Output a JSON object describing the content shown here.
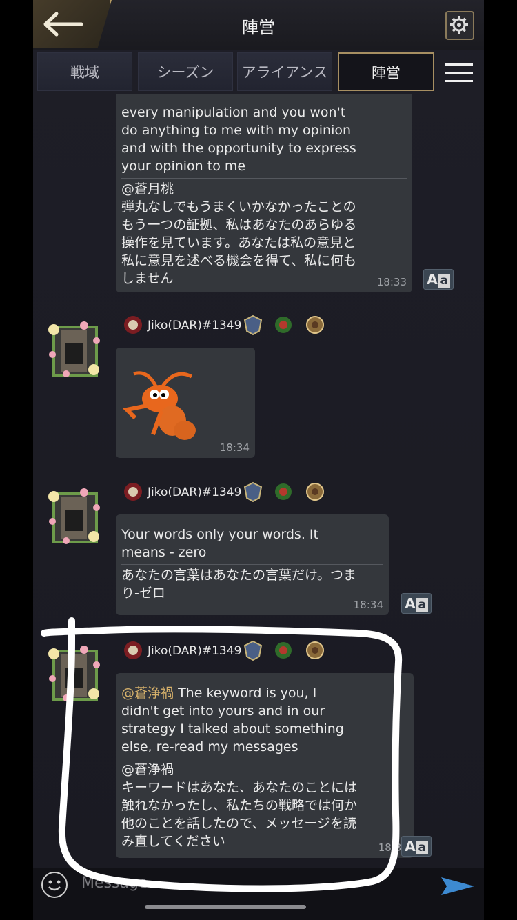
{
  "header": {
    "title": "陣営"
  },
  "tabs": [
    {
      "label": "戦域"
    },
    {
      "label": "シーズン"
    },
    {
      "label": "アライアンス"
    },
    {
      "label": "陣営"
    }
  ],
  "messages": [
    {
      "original_text": "every manipulation and you won't do anything to me with my opinion and with the opportunity to express your opinion to me",
      "translated_mention": "@蒼月桃",
      "translated_text": "弾丸なしでもうまくいかなかったことのもう一つの証拠、私はあなたのあらゆる操作を見ています。あなたは私の意見と私に意見を述べる機会を得て、私に何もしません",
      "time": "18:33"
    },
    {
      "user": "Jiko(DAR)#1349",
      "type": "sticker",
      "sticker": "ant-sticker",
      "time": "18:34"
    },
    {
      "user": "Jiko(DAR)#1349",
      "original_text": "Your words only your words. It means - zero",
      "translated_text": "あなたの言葉はあなたの言葉だけ。つまり-ゼロ",
      "time": "18:34"
    },
    {
      "user": "Jiko(DAR)#1349",
      "mention": "@蒼浄禍",
      "original_text": "The keyword is you, I didn't get into yours and in our strategy I talked about something else, re-read my messages",
      "translated_mention": "@蒼浄禍",
      "translated_text": "キーワードはあなた、あなたのことには触れなかったし、私たちの戦略では何か他のことを話したので、メッセージを読み直してください",
      "time": "18:36"
    }
  ],
  "translate_button": {
    "label_a": "A",
    "label_b": "a"
  },
  "input": {
    "placeholder": "Message"
  }
}
